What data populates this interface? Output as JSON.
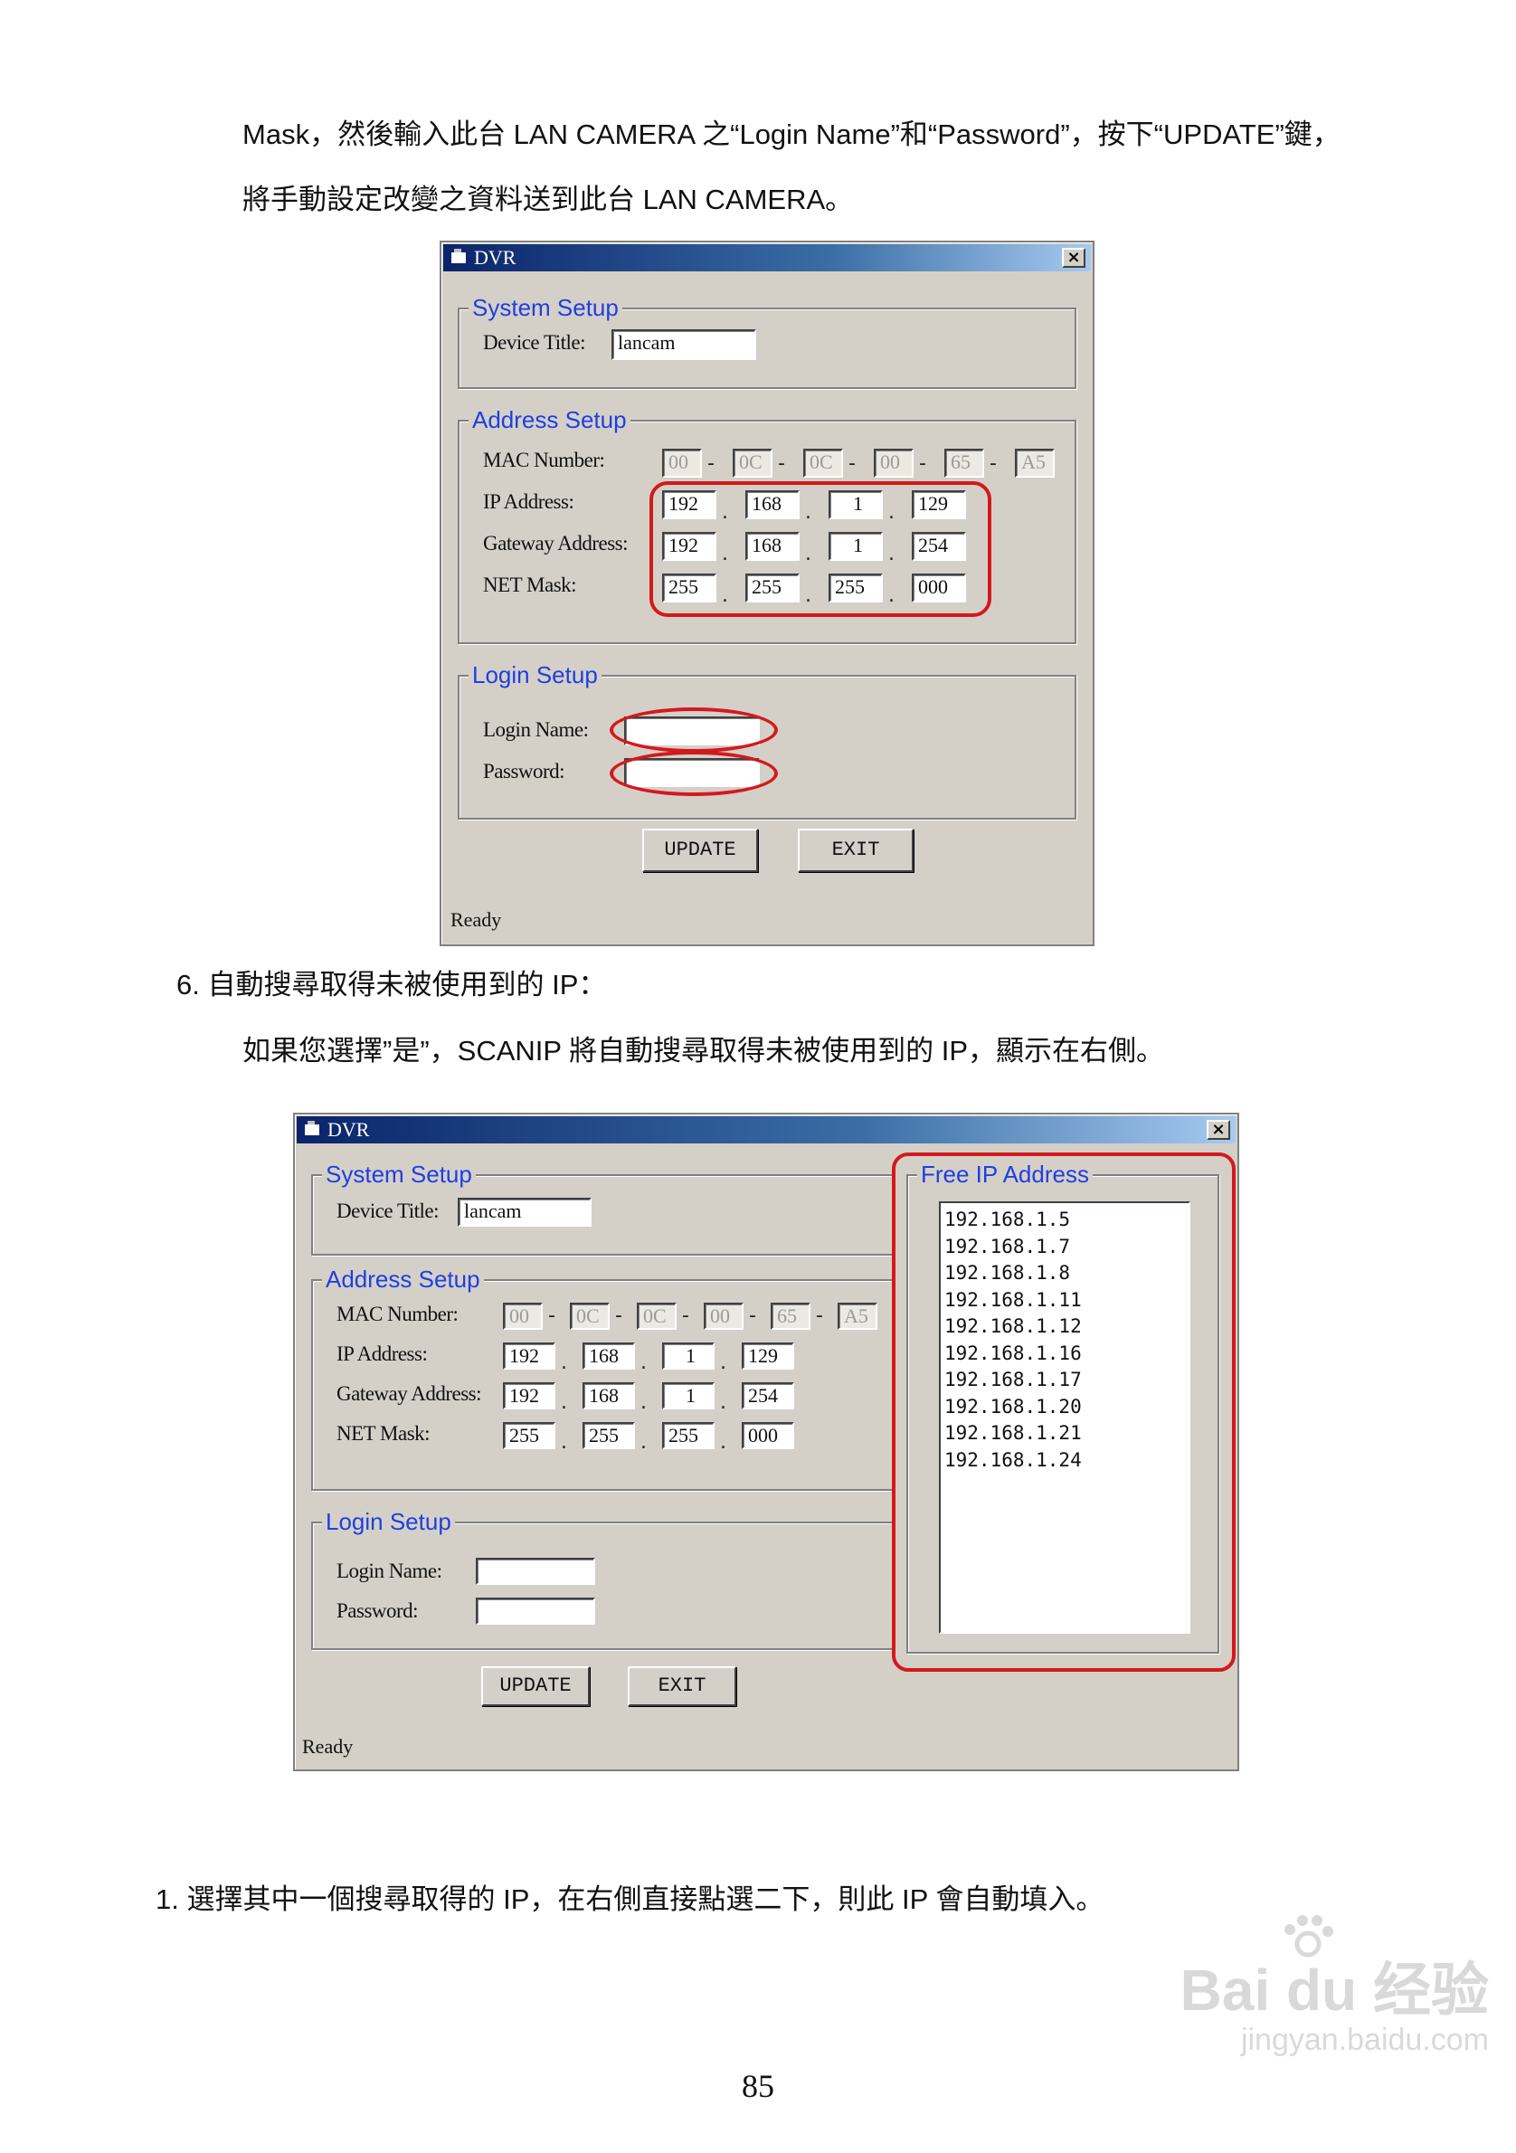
{
  "paragraphs": {
    "p1": "Mask，然後輸入此台 LAN CAMERA 之“Login Name”和“Password”，按下“UPDATE”鍵，",
    "p2": "將手動設定改變之資料送到此台 LAN CAMERA。",
    "p3": "6.  自動搜尋取得未被使用到的 IP：",
    "p4": "如果您選擇”是”，SCANIP 將自動搜尋取得未被使用到的 IP，顯示在右側。",
    "p5": "1.  選擇其中一個搜尋取得的 IP，在右側直接點選二下，則此 IP 會自動填入。"
  },
  "dialog": {
    "title": "DVR",
    "close_glyph": "×",
    "system_setup": "System Setup",
    "device_title_label": "Device Title:",
    "device_title_value": "lancam",
    "address_setup": "Address Setup",
    "mac_label": "MAC Number:",
    "ip_label": "IP Address:",
    "gateway_label": "Gateway Address:",
    "netmask_label": "NET Mask:",
    "mac": [
      "00",
      "0C",
      "0C",
      "00",
      "65",
      "A5"
    ],
    "ip": [
      "192",
      "168",
      "1",
      "129"
    ],
    "gateway": [
      "192",
      "168",
      "1",
      "254"
    ],
    "netmask": [
      "255",
      "255",
      "255",
      "000"
    ],
    "login_setup": "Login Setup",
    "login_name_label": "Login Name:",
    "password_label": "Password:",
    "update_button": "UPDATE",
    "exit_button": "EXIT",
    "status": "Ready",
    "free_ip_title": "Free IP Address",
    "free_ips": [
      "192.168.1.5",
      "192.168.1.7",
      "192.168.1.8",
      "192.168.1.11",
      "192.168.1.12",
      "192.168.1.16",
      "192.168.1.17",
      "192.168.1.20",
      "192.168.1.21",
      "192.168.1.24"
    ]
  },
  "page_number": "85",
  "watermark": {
    "brand": "Bai du 经验",
    "url": "jingyan.baidu.com"
  },
  "colors": {
    "highlight": "#d3191c",
    "legend": "#1f3fe0",
    "dialog_bg": "#d4d0c8"
  }
}
